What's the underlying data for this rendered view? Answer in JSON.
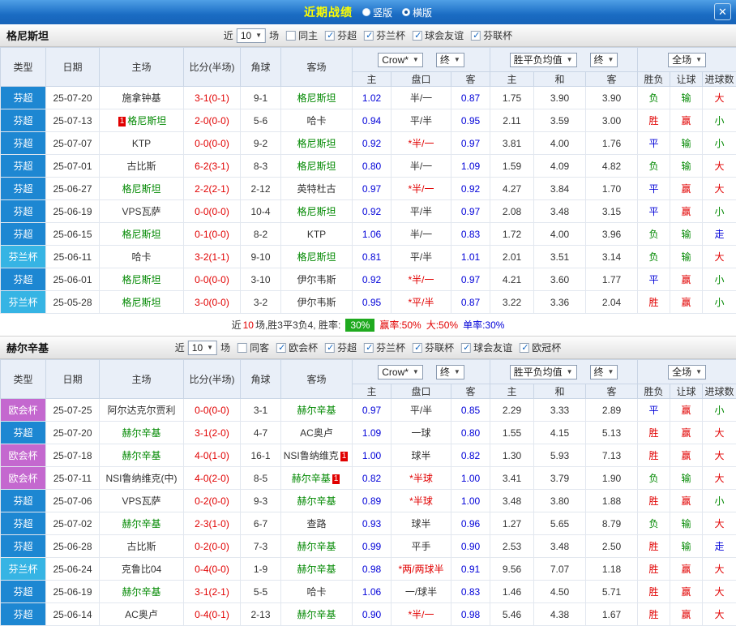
{
  "header": {
    "title": "近期战绩",
    "close_glyph": "✕",
    "view_options": [
      {
        "label": "竖版",
        "checked": "false"
      },
      {
        "label": "横版",
        "checked": "true"
      }
    ]
  },
  "columns": {
    "type": "类型",
    "date": "日期",
    "home": "主场",
    "score": "比分(半场)",
    "corner": "角球",
    "away": "客场",
    "odds_source": "Crow*",
    "final": "终",
    "odds_sub": [
      "主",
      "盘口",
      "客"
    ],
    "avg_label": "胜平负均值",
    "avg_sub": [
      "主",
      "和",
      "客"
    ],
    "scope": "全场",
    "result_sub": [
      "胜负",
      "让球",
      "进球数"
    ]
  },
  "sections": [
    {
      "team": "格尼斯坦",
      "near_label": "近",
      "near_count": "10",
      "games_label": "场",
      "filters": [
        {
          "label": "同主",
          "checked": "false"
        },
        {
          "label": "芬超",
          "checked": "true"
        },
        {
          "label": "芬兰杯",
          "checked": "true"
        },
        {
          "label": "球会友谊",
          "checked": "true"
        },
        {
          "label": "芬联杯",
          "checked": "true"
        }
      ],
      "rows": [
        {
          "league": "芬超",
          "lgc": "lg-super",
          "date": "25-07-20",
          "home": "施拿钟基",
          "homeFocus": false,
          "homeBadge": "",
          "homeBadgePos": "",
          "score": "3-1(0-1)",
          "corner": "9-1",
          "away": "格尼斯坦",
          "awayFocus": true,
          "awayBadge": "",
          "awayBadgePos": "",
          "o1": "1.02",
          "hc": "半/一",
          "hcc": "c-black",
          "o2": "0.87",
          "a1": "1.75",
          "a2": "3.90",
          "a3": "3.90",
          "r1": "负",
          "r1c": "c-green",
          "r2": "输",
          "r2c": "c-green",
          "r3": "大",
          "r3c": "c-red"
        },
        {
          "league": "芬超",
          "lgc": "lg-super",
          "date": "25-07-13",
          "home": "格尼斯坦",
          "homeFocus": true,
          "homeBadge": "1",
          "homeBadgePos": "before",
          "score": "2-0(0-0)",
          "corner": "5-6",
          "away": "哈卡",
          "awayFocus": false,
          "awayBadge": "",
          "awayBadgePos": "",
          "o1": "0.94",
          "hc": "平/半",
          "hcc": "c-black",
          "o2": "0.95",
          "a1": "2.11",
          "a2": "3.59",
          "a3": "3.00",
          "r1": "胜",
          "r1c": "c-red",
          "r2": "赢",
          "r2c": "c-red",
          "r3": "小",
          "r3c": "c-green"
        },
        {
          "league": "芬超",
          "lgc": "lg-super",
          "date": "25-07-07",
          "home": "KTP",
          "homeFocus": false,
          "homeBadge": "",
          "homeBadgePos": "",
          "score": "0-0(0-0)",
          "corner": "9-2",
          "away": "格尼斯坦",
          "awayFocus": true,
          "awayBadge": "",
          "awayBadgePos": "",
          "o1": "0.92",
          "hc": "*半/一",
          "hcc": "c-red",
          "o2": "0.97",
          "a1": "3.81",
          "a2": "4.00",
          "a3": "1.76",
          "r1": "平",
          "r1c": "c-blue",
          "r2": "输",
          "r2c": "c-green",
          "r3": "小",
          "r3c": "c-green"
        },
        {
          "league": "芬超",
          "lgc": "lg-super",
          "date": "25-07-01",
          "home": "古比斯",
          "homeFocus": false,
          "homeBadge": "",
          "homeBadgePos": "",
          "score": "6-2(3-1)",
          "corner": "8-3",
          "away": "格尼斯坦",
          "awayFocus": true,
          "awayBadge": "",
          "awayBadgePos": "",
          "o1": "0.80",
          "hc": "半/一",
          "hcc": "c-black",
          "o2": "1.09",
          "a1": "1.59",
          "a2": "4.09",
          "a3": "4.82",
          "r1": "负",
          "r1c": "c-green",
          "r2": "输",
          "r2c": "c-green",
          "r3": "大",
          "r3c": "c-red"
        },
        {
          "league": "芬超",
          "lgc": "lg-super",
          "date": "25-06-27",
          "home": "格尼斯坦",
          "homeFocus": true,
          "homeBadge": "",
          "homeBadgePos": "",
          "score": "2-2(2-1)",
          "corner": "2-12",
          "away": "英特杜古",
          "awayFocus": false,
          "awayBadge": "",
          "awayBadgePos": "",
          "o1": "0.97",
          "hc": "*半/一",
          "hcc": "c-red",
          "o2": "0.92",
          "a1": "4.27",
          "a2": "3.84",
          "a3": "1.70",
          "r1": "平",
          "r1c": "c-blue",
          "r2": "赢",
          "r2c": "c-red",
          "r3": "大",
          "r3c": "c-red"
        },
        {
          "league": "芬超",
          "lgc": "lg-super",
          "date": "25-06-19",
          "home": "VPS瓦萨",
          "homeFocus": false,
          "homeBadge": "",
          "homeBadgePos": "",
          "score": "0-0(0-0)",
          "corner": "10-4",
          "away": "格尼斯坦",
          "awayFocus": true,
          "awayBadge": "",
          "awayBadgePos": "",
          "o1": "0.92",
          "hc": "平/半",
          "hcc": "c-black",
          "o2": "0.97",
          "a1": "2.08",
          "a2": "3.48",
          "a3": "3.15",
          "r1": "平",
          "r1c": "c-blue",
          "r2": "赢",
          "r2c": "c-red",
          "r3": "小",
          "r3c": "c-green"
        },
        {
          "league": "芬超",
          "lgc": "lg-super",
          "date": "25-06-15",
          "home": "格尼斯坦",
          "homeFocus": true,
          "homeBadge": "",
          "homeBadgePos": "",
          "score": "0-1(0-0)",
          "corner": "8-2",
          "away": "KTP",
          "awayFocus": false,
          "awayBadge": "",
          "awayBadgePos": "",
          "o1": "1.06",
          "hc": "半/一",
          "hcc": "c-black",
          "o2": "0.83",
          "a1": "1.72",
          "a2": "4.00",
          "a3": "3.96",
          "r1": "负",
          "r1c": "c-green",
          "r2": "输",
          "r2c": "c-green",
          "r3": "走",
          "r3c": "c-blue"
        },
        {
          "league": "芬兰杯",
          "lgc": "lg-cup",
          "date": "25-06-11",
          "home": "哈卡",
          "homeFocus": false,
          "homeBadge": "",
          "homeBadgePos": "",
          "score": "3-2(1-1)",
          "corner": "9-10",
          "away": "格尼斯坦",
          "awayFocus": true,
          "awayBadge": "",
          "awayBadgePos": "",
          "o1": "0.81",
          "hc": "平/半",
          "hcc": "c-black",
          "o2": "1.01",
          "a1": "2.01",
          "a2": "3.51",
          "a3": "3.14",
          "r1": "负",
          "r1c": "c-green",
          "r2": "输",
          "r2c": "c-green",
          "r3": "大",
          "r3c": "c-red"
        },
        {
          "league": "芬超",
          "lgc": "lg-super",
          "date": "25-06-01",
          "home": "格尼斯坦",
          "homeFocus": true,
          "homeBadge": "",
          "homeBadgePos": "",
          "score": "0-0(0-0)",
          "corner": "3-10",
          "away": "伊尔韦斯",
          "awayFocus": false,
          "awayBadge": "",
          "awayBadgePos": "",
          "o1": "0.92",
          "hc": "*半/一",
          "hcc": "c-red",
          "o2": "0.97",
          "a1": "4.21",
          "a2": "3.60",
          "a3": "1.77",
          "r1": "平",
          "r1c": "c-blue",
          "r2": "赢",
          "r2c": "c-red",
          "r3": "小",
          "r3c": "c-green"
        },
        {
          "league": "芬兰杯",
          "lgc": "lg-cup",
          "date": "25-05-28",
          "home": "格尼斯坦",
          "homeFocus": true,
          "homeBadge": "",
          "homeBadgePos": "",
          "score": "3-0(0-0)",
          "corner": "3-2",
          "away": "伊尔韦斯",
          "awayFocus": false,
          "awayBadge": "",
          "awayBadgePos": "",
          "o1": "0.95",
          "hc": "*平/半",
          "hcc": "c-red",
          "o2": "0.87",
          "a1": "3.22",
          "a2": "3.36",
          "a3": "2.04",
          "r1": "胜",
          "r1c": "c-red",
          "r2": "赢",
          "r2c": "c-red",
          "r3": "小",
          "r3c": "c-green"
        }
      ],
      "summary": {
        "pre": "近",
        "count": "10",
        "mid": "场,胜3平3负4, 胜率:",
        "rate_badge": "30%",
        "win_rate": "赢率:50%",
        "big_rate": "大:50%",
        "single_rate": "单率:30%"
      }
    },
    {
      "team": "赫尔辛基",
      "near_label": "近",
      "near_count": "10",
      "games_label": "场",
      "filters": [
        {
          "label": "同客",
          "checked": "false"
        },
        {
          "label": "欧会杯",
          "checked": "true"
        },
        {
          "label": "芬超",
          "checked": "true"
        },
        {
          "label": "芬兰杯",
          "checked": "true"
        },
        {
          "label": "芬联杯",
          "checked": "true"
        },
        {
          "label": "球会友谊",
          "checked": "true"
        },
        {
          "label": "欧冠杯",
          "checked": "true"
        }
      ],
      "rows": [
        {
          "league": "欧会杯",
          "lgc": "lg-conf",
          "date": "25-07-25",
          "home": "阿尔达克尔贾利",
          "homeFocus": false,
          "homeBadge": "",
          "homeBadgePos": "",
          "score": "0-0(0-0)",
          "corner": "3-1",
          "away": "赫尔辛基",
          "awayFocus": true,
          "awayBadge": "",
          "awayBadgePos": "",
          "o1": "0.97",
          "hc": "平/半",
          "hcc": "c-black",
          "o2": "0.85",
          "a1": "2.29",
          "a2": "3.33",
          "a3": "2.89",
          "r1": "平",
          "r1c": "c-blue",
          "r2": "赢",
          "r2c": "c-red",
          "r3": "小",
          "r3c": "c-green"
        },
        {
          "league": "芬超",
          "lgc": "lg-super",
          "date": "25-07-20",
          "home": "赫尔辛基",
          "homeFocus": true,
          "homeBadge": "",
          "homeBadgePos": "",
          "score": "3-1(2-0)",
          "corner": "4-7",
          "away": "AC奥卢",
          "awayFocus": false,
          "awayBadge": "",
          "awayBadgePos": "",
          "o1": "1.09",
          "hc": "一球",
          "hcc": "c-black",
          "o2": "0.80",
          "a1": "1.55",
          "a2": "4.15",
          "a3": "5.13",
          "r1": "胜",
          "r1c": "c-red",
          "r2": "赢",
          "r2c": "c-red",
          "r3": "大",
          "r3c": "c-red"
        },
        {
          "league": "欧会杯",
          "lgc": "lg-conf",
          "date": "25-07-18",
          "home": "赫尔辛基",
          "homeFocus": true,
          "homeBadge": "",
          "homeBadgePos": "",
          "score": "4-0(1-0)",
          "corner": "16-1",
          "away": "NSI鲁纳维克",
          "awayFocus": false,
          "awayBadge": "1",
          "awayBadgePos": "after",
          "o1": "1.00",
          "hc": "球半",
          "hcc": "c-black",
          "o2": "0.82",
          "a1": "1.30",
          "a2": "5.93",
          "a3": "7.13",
          "r1": "胜",
          "r1c": "c-red",
          "r2": "赢",
          "r2c": "c-red",
          "r3": "大",
          "r3c": "c-red"
        },
        {
          "league": "欧会杯",
          "lgc": "lg-conf",
          "date": "25-07-11",
          "home": "NSI鲁纳维克(中)",
          "homeFocus": false,
          "homeBadge": "",
          "homeBadgePos": "",
          "score": "4-0(2-0)",
          "corner": "8-5",
          "away": "赫尔辛基",
          "awayFocus": true,
          "awayBadge": "1",
          "awayBadgePos": "after",
          "o1": "0.82",
          "hc": "*半球",
          "hcc": "c-red",
          "o2": "1.00",
          "a1": "3.41",
          "a2": "3.79",
          "a3": "1.90",
          "r1": "负",
          "r1c": "c-green",
          "r2": "输",
          "r2c": "c-green",
          "r3": "大",
          "r3c": "c-red"
        },
        {
          "league": "芬超",
          "lgc": "lg-super",
          "date": "25-07-06",
          "home": "VPS瓦萨",
          "homeFocus": false,
          "homeBadge": "",
          "homeBadgePos": "",
          "score": "0-2(0-0)",
          "corner": "9-3",
          "away": "赫尔辛基",
          "awayFocus": true,
          "awayBadge": "",
          "awayBadgePos": "",
          "o1": "0.89",
          "hc": "*半球",
          "hcc": "c-red",
          "o2": "1.00",
          "a1": "3.48",
          "a2": "3.80",
          "a3": "1.88",
          "r1": "胜",
          "r1c": "c-red",
          "r2": "赢",
          "r2c": "c-red",
          "r3": "小",
          "r3c": "c-green"
        },
        {
          "league": "芬超",
          "lgc": "lg-super",
          "date": "25-07-02",
          "home": "赫尔辛基",
          "homeFocus": true,
          "homeBadge": "",
          "homeBadgePos": "",
          "score": "2-3(1-0)",
          "corner": "6-7",
          "away": "查路",
          "awayFocus": false,
          "awayBadge": "",
          "awayBadgePos": "",
          "o1": "0.93",
          "hc": "球半",
          "hcc": "c-black",
          "o2": "0.96",
          "a1": "1.27",
          "a2": "5.65",
          "a3": "8.79",
          "r1": "负",
          "r1c": "c-green",
          "r2": "输",
          "r2c": "c-green",
          "r3": "大",
          "r3c": "c-red"
        },
        {
          "league": "芬超",
          "lgc": "lg-super",
          "date": "25-06-28",
          "home": "古比斯",
          "homeFocus": false,
          "homeBadge": "",
          "homeBadgePos": "",
          "score": "0-2(0-0)",
          "corner": "7-3",
          "away": "赫尔辛基",
          "awayFocus": true,
          "awayBadge": "",
          "awayBadgePos": "",
          "o1": "0.99",
          "hc": "平手",
          "hcc": "c-black",
          "o2": "0.90",
          "a1": "2.53",
          "a2": "3.48",
          "a3": "2.50",
          "r1": "胜",
          "r1c": "c-red",
          "r2": "输",
          "r2c": "c-green",
          "r3": "走",
          "r3c": "c-blue"
        },
        {
          "league": "芬兰杯",
          "lgc": "lg-cup",
          "date": "25-06-24",
          "home": "克鲁比04",
          "homeFocus": false,
          "homeBadge": "",
          "homeBadgePos": "",
          "score": "0-4(0-0)",
          "corner": "1-9",
          "away": "赫尔辛基",
          "awayFocus": true,
          "awayBadge": "",
          "awayBadgePos": "",
          "o1": "0.98",
          "hc": "*两/两球半",
          "hcc": "c-red",
          "o2": "0.91",
          "a1": "9.56",
          "a2": "7.07",
          "a3": "1.18",
          "r1": "胜",
          "r1c": "c-red",
          "r2": "赢",
          "r2c": "c-red",
          "r3": "大",
          "r3c": "c-red"
        },
        {
          "league": "芬超",
          "lgc": "lg-super",
          "date": "25-06-19",
          "home": "赫尔辛基",
          "homeFocus": true,
          "homeBadge": "",
          "homeBadgePos": "",
          "score": "3-1(2-1)",
          "corner": "5-5",
          "away": "哈卡",
          "awayFocus": false,
          "awayBadge": "",
          "awayBadgePos": "",
          "o1": "1.06",
          "hc": "一/球半",
          "hcc": "c-black",
          "o2": "0.83",
          "a1": "1.46",
          "a2": "4.50",
          "a3": "5.71",
          "r1": "胜",
          "r1c": "c-red",
          "r2": "赢",
          "r2c": "c-red",
          "r3": "大",
          "r3c": "c-red"
        },
        {
          "league": "芬超",
          "lgc": "lg-super",
          "date": "25-06-14",
          "home": "AC奥卢",
          "homeFocus": false,
          "homeBadge": "",
          "homeBadgePos": "",
          "score": "0-4(0-1)",
          "corner": "2-13",
          "away": "赫尔辛基",
          "awayFocus": true,
          "awayBadge": "",
          "awayBadgePos": "",
          "o1": "0.90",
          "hc": "*半/一",
          "hcc": "c-red",
          "o2": "0.98",
          "a1": "5.46",
          "a2": "4.38",
          "a3": "1.67",
          "r1": "胜",
          "r1c": "c-red",
          "r2": "赢",
          "r2c": "c-red",
          "r3": "大",
          "r3c": "c-red"
        }
      ],
      "summary": null
    }
  ]
}
